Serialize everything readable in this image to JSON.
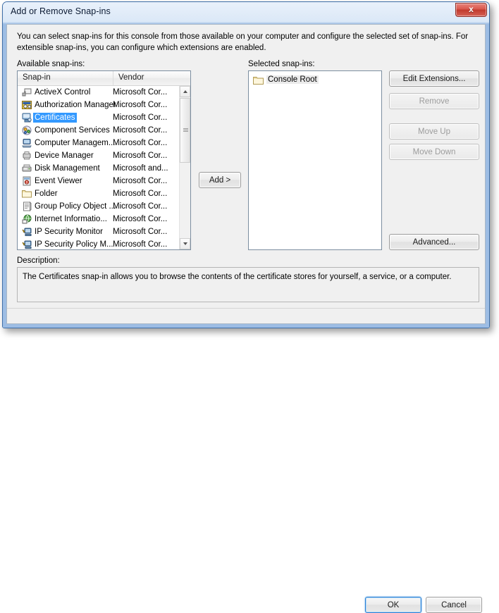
{
  "window": {
    "title": "Add or Remove Snap-ins",
    "close_label": "x",
    "close_icon": "close-icon"
  },
  "intro": "You can select snap-ins for this console from those available on your computer and configure the selected set of snap-ins. For extensible snap-ins, you can configure which extensions are enabled.",
  "available": {
    "label": "Available snap-ins:",
    "columns": [
      "Snap-in",
      "Vendor"
    ],
    "rows": [
      {
        "name": "ActiveX Control",
        "vendor": "Microsoft Cor...",
        "icon": "activex-control-icon",
        "selected": false
      },
      {
        "name": "Authorization Manager",
        "vendor": "Microsoft Cor...",
        "icon": "authorization-manager-icon",
        "selected": false
      },
      {
        "name": "Certificates",
        "vendor": "Microsoft Cor...",
        "icon": "certificates-icon",
        "selected": true
      },
      {
        "name": "Component Services",
        "vendor": "Microsoft Cor...",
        "icon": "component-services-icon",
        "selected": false
      },
      {
        "name": "Computer Managem...",
        "vendor": "Microsoft Cor...",
        "icon": "computer-management-icon",
        "selected": false
      },
      {
        "name": "Device Manager",
        "vendor": "Microsoft Cor...",
        "icon": "device-manager-icon",
        "selected": false
      },
      {
        "name": "Disk Management",
        "vendor": "Microsoft and...",
        "icon": "disk-management-icon",
        "selected": false
      },
      {
        "name": "Event Viewer",
        "vendor": "Microsoft Cor...",
        "icon": "event-viewer-icon",
        "selected": false
      },
      {
        "name": "Folder",
        "vendor": "Microsoft Cor...",
        "icon": "folder-icon",
        "selected": false
      },
      {
        "name": "Group Policy Object ...",
        "vendor": "Microsoft Cor...",
        "icon": "group-policy-object-icon",
        "selected": false
      },
      {
        "name": "Internet Informatio...",
        "vendor": "Microsoft Cor...",
        "icon": "internet-information-services-icon",
        "selected": false
      },
      {
        "name": "IP Security Monitor",
        "vendor": "Microsoft Cor...",
        "icon": "ip-security-monitor-icon",
        "selected": false
      },
      {
        "name": "IP Security Policy M...",
        "vendor": "Microsoft Cor...",
        "icon": "ip-security-policy-icon",
        "selected": false
      },
      {
        "name": "",
        "vendor": "",
        "icon": "partial-row-icon",
        "selected": false
      }
    ],
    "scrollbar": {
      "up_icon": "scroll-up-arrow-icon",
      "down_icon": "scroll-down-arrow-icon",
      "thumb_icon": "scrollbar-thumb"
    }
  },
  "add_button": {
    "label": "Add >"
  },
  "selected": {
    "label": "Selected snap-ins:",
    "items": [
      {
        "name": "Console Root",
        "icon": "folder-icon",
        "highlighted": true
      }
    ]
  },
  "side_buttons": [
    {
      "id": "edit-extensions",
      "label": "Edit Extensions...",
      "disabled": false
    },
    {
      "id": "remove",
      "label": "Remove",
      "disabled": true
    },
    {
      "id": "move-up",
      "label": "Move Up",
      "disabled": true
    },
    {
      "id": "move-down",
      "label": "Move Down",
      "disabled": true
    },
    {
      "id": "advanced",
      "label": "Advanced...",
      "disabled": false
    }
  ],
  "description": {
    "label": "Description:",
    "text": "The Certificates snap-in allows you to browse the contents of the certificate stores for yourself, a service, or a computer."
  },
  "footer": {
    "ok_label": "OK",
    "cancel_label": "Cancel"
  },
  "colors": {
    "selection_blue": "#3399ff",
    "title_text": "#0b1a33",
    "close_red": "#c03a2d",
    "dialog_bg": "#f0f0f0",
    "default_button_focus": "#2b7fd4"
  }
}
